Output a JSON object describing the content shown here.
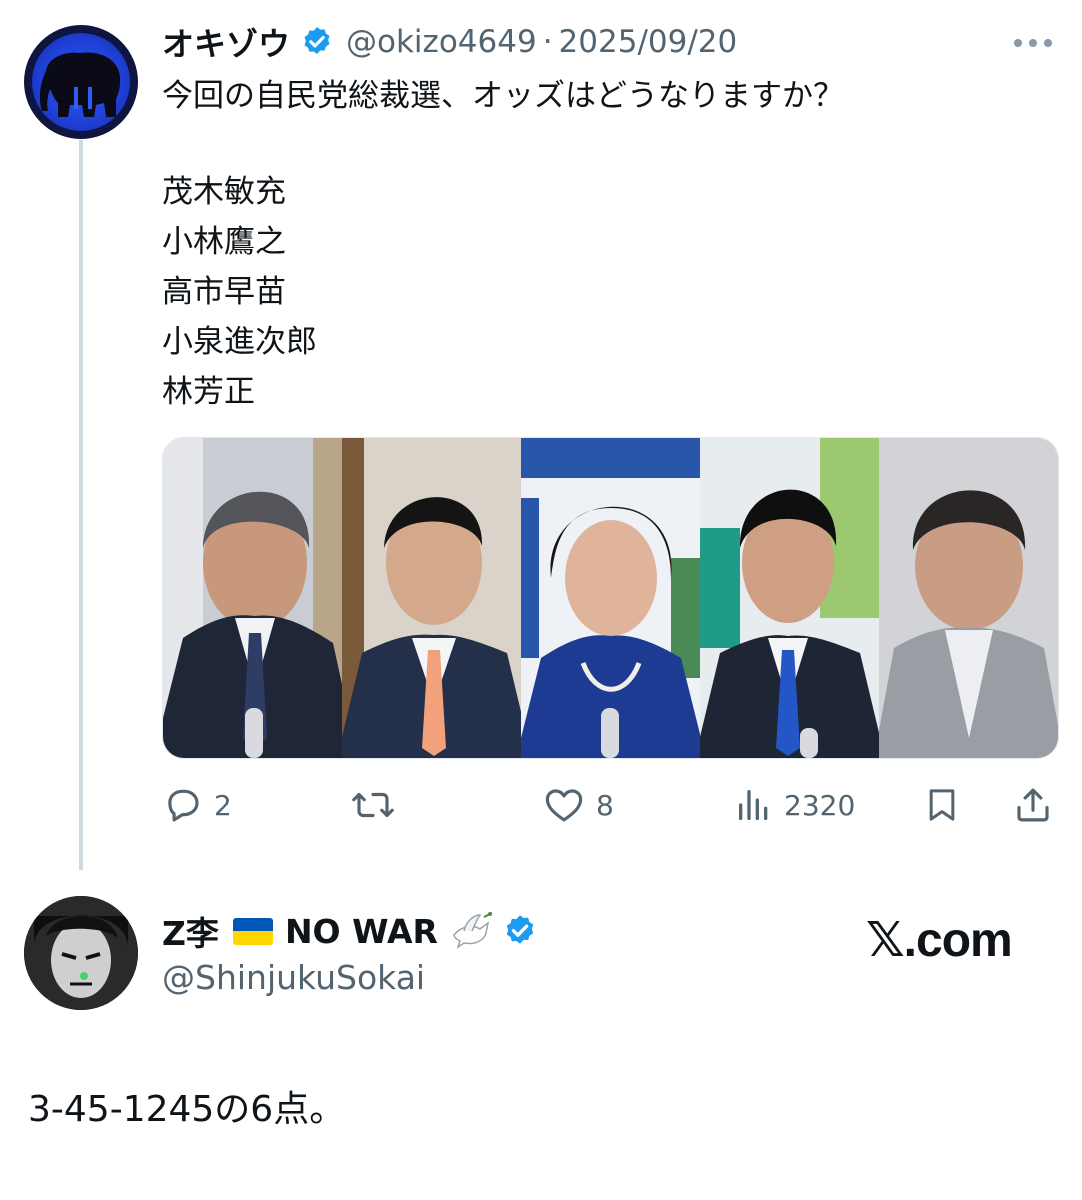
{
  "tweet": {
    "display_name": "オキゾウ",
    "handle": "@okizo4649",
    "separator": "·",
    "date": "2025/09/20",
    "question": "今回の自民党総裁選、オッズはどうなりますか？",
    "candidates": [
      "茂木敏充",
      "小林鷹之",
      "高市早苗",
      "小泉進次郎",
      "林芳正"
    ],
    "actions": {
      "replies": "2",
      "retweets": "",
      "likes": "8",
      "views": "2320"
    }
  },
  "reply": {
    "display_name": "Z李",
    "flag_icon": "ukraine-flag-icon",
    "no_war": "NO WAR",
    "dove_icon": "dove-icon",
    "handle": "@ShinjukuSokai",
    "text": "3-45-1245の6点。"
  },
  "watermark": "𝕏.com",
  "colors": {
    "verified": "#1d9bf0",
    "text_primary": "#0f1419",
    "text_secondary": "#536471",
    "thread_line": "#cfd9de"
  }
}
